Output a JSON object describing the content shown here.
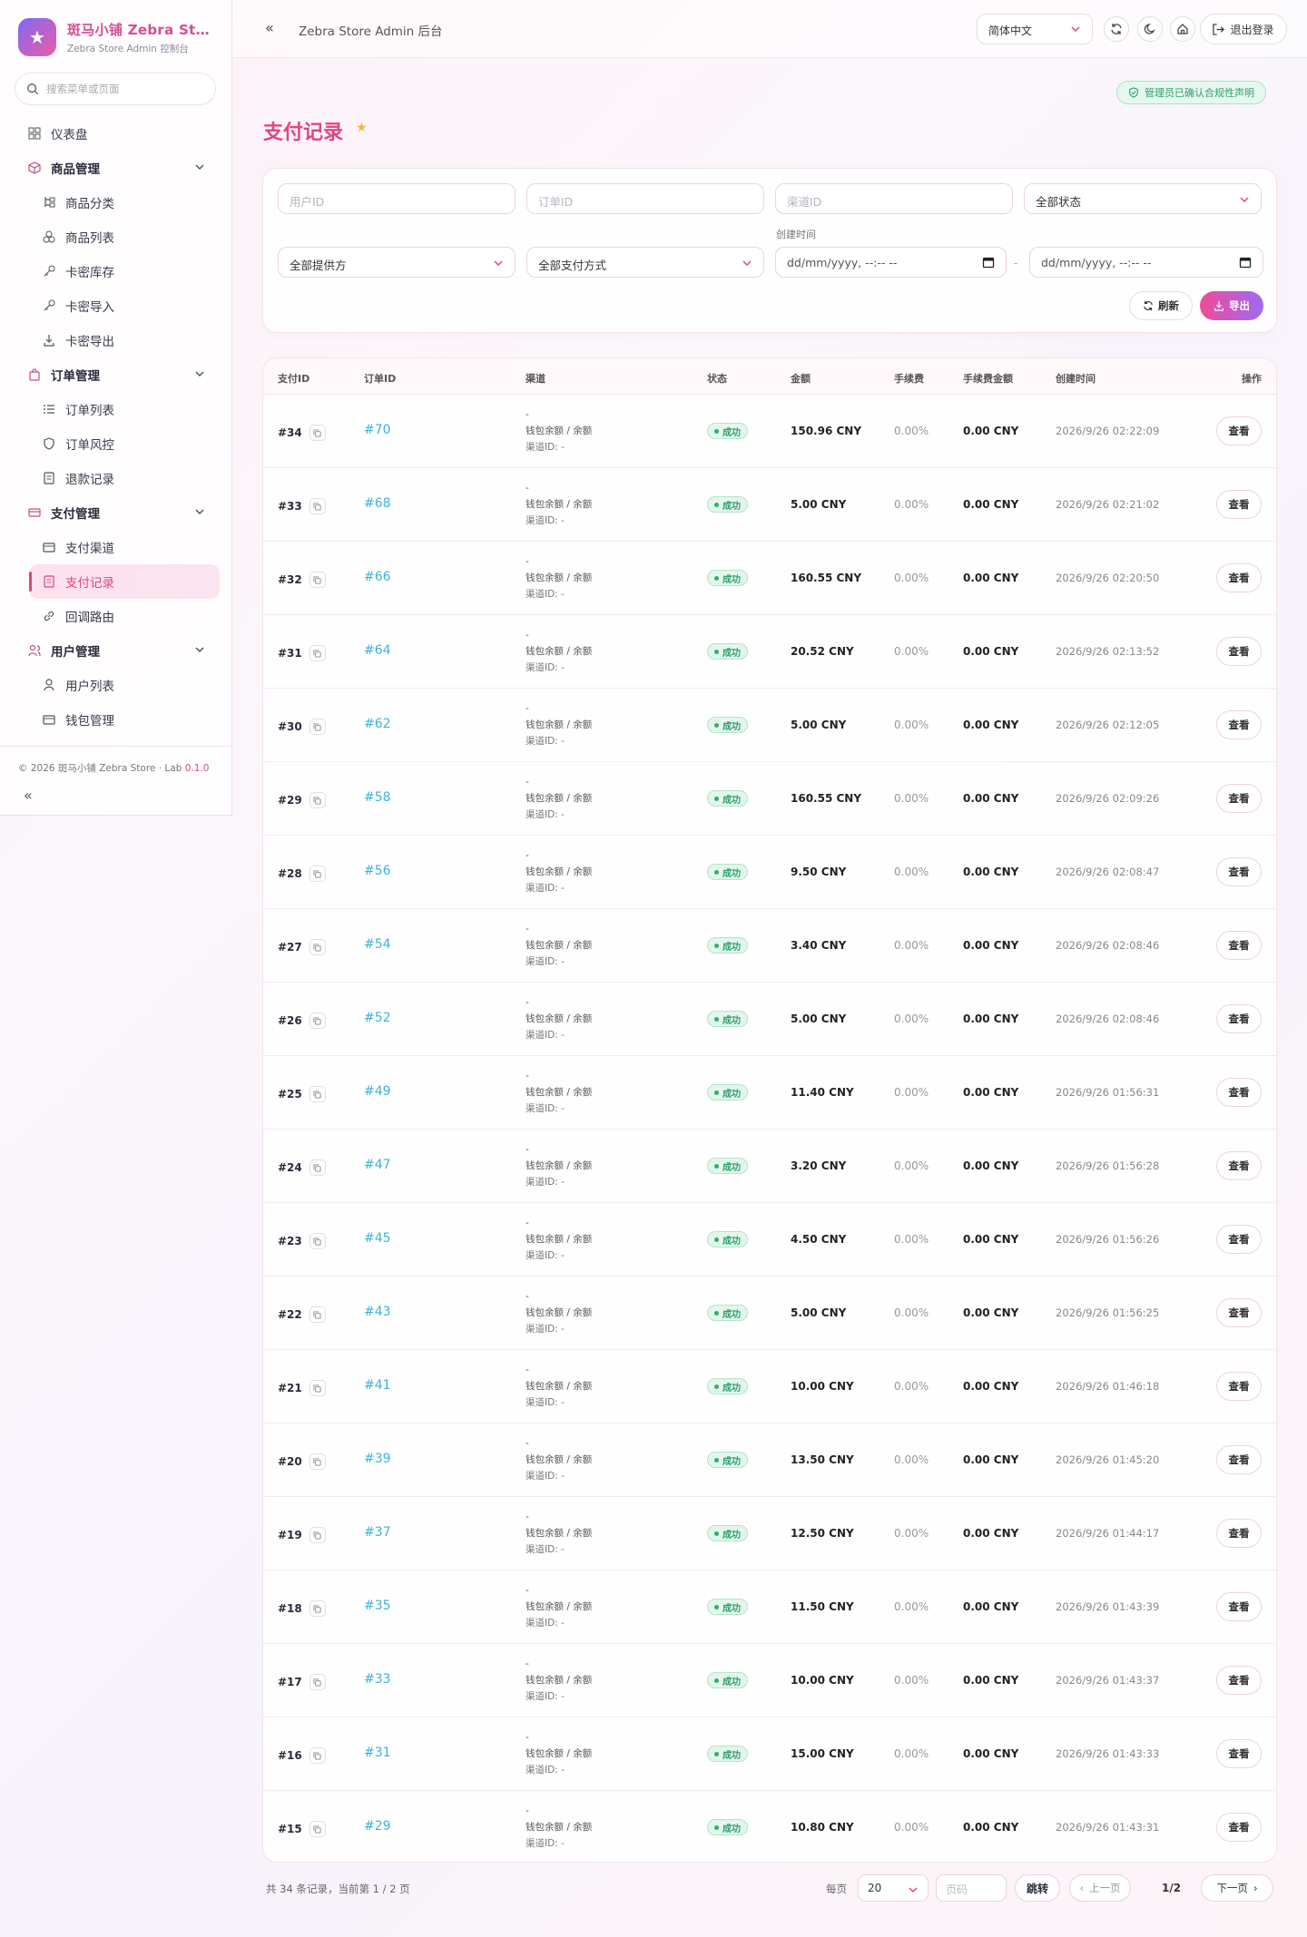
{
  "brand": {
    "title": "斑马小铺 Zebra St…",
    "subtitle": "Zebra Store Admin 控制台"
  },
  "sidebar": {
    "search_placeholder": "搜索菜单或页面",
    "dashboard": "仪表盘",
    "groups": [
      {
        "label": "商品管理",
        "items": [
          "商品分类",
          "商品列表",
          "卡密库存",
          "卡密导入",
          "卡密导出"
        ]
      },
      {
        "label": "订单管理",
        "items": [
          "订单列表",
          "订单风控",
          "退款记录"
        ]
      },
      {
        "label": "支付管理",
        "items": [
          "支付渠道",
          "支付记录",
          "回调路由"
        ]
      },
      {
        "label": "用户管理",
        "items": [
          "用户列表",
          "钱包管理"
        ]
      }
    ],
    "copyright": "© 2026 斑马小铺 Zebra Store · Lab",
    "version": "0.1.0"
  },
  "topbar": {
    "title": "Zebra Store Admin 后台",
    "language": "简体中文",
    "logout": "退出登录"
  },
  "compliance": "管理员已确认合规性声明",
  "page_title": "支付记录",
  "filters": {
    "user_id": "用户ID",
    "order_id": "订单ID",
    "channel_id": "渠道ID",
    "status": "全部状态",
    "provider": "全部提供方",
    "method": "全部支付方式",
    "created_label": "创建时间",
    "date_placeholder": "dd/mm/yyyy, --:-- --",
    "refresh": "刷新",
    "export": "导出"
  },
  "table": {
    "headers": [
      "支付ID",
      "订单ID",
      "渠道",
      "状态",
      "金额",
      "手续费",
      "手续费金额",
      "创建时间",
      "操作"
    ],
    "channel_dash": "-",
    "channel_name": "钱包余额 / 余额",
    "channel_id_label": "渠道ID: -",
    "status_label": "成功",
    "fee": "0.00%",
    "fee_amount": "0.00 CNY",
    "view_label": "查看",
    "rows": [
      {
        "pid": "#34",
        "oid": "#70",
        "amount": "150.96 CNY",
        "time": "2026/9/26 02:22:09"
      },
      {
        "pid": "#33",
        "oid": "#68",
        "amount": "5.00 CNY",
        "time": "2026/9/26 02:21:02"
      },
      {
        "pid": "#32",
        "oid": "#66",
        "amount": "160.55 CNY",
        "time": "2026/9/26 02:20:50"
      },
      {
        "pid": "#31",
        "oid": "#64",
        "amount": "20.52 CNY",
        "time": "2026/9/26 02:13:52"
      },
      {
        "pid": "#30",
        "oid": "#62",
        "amount": "5.00 CNY",
        "time": "2026/9/26 02:12:05"
      },
      {
        "pid": "#29",
        "oid": "#58",
        "amount": "160.55 CNY",
        "time": "2026/9/26 02:09:26"
      },
      {
        "pid": "#28",
        "oid": "#56",
        "amount": "9.50 CNY",
        "time": "2026/9/26 02:08:47"
      },
      {
        "pid": "#27",
        "oid": "#54",
        "amount": "3.40 CNY",
        "time": "2026/9/26 02:08:46"
      },
      {
        "pid": "#26",
        "oid": "#52",
        "amount": "5.00 CNY",
        "time": "2026/9/26 02:08:46"
      },
      {
        "pid": "#25",
        "oid": "#49",
        "amount": "11.40 CNY",
        "time": "2026/9/26 01:56:31"
      },
      {
        "pid": "#24",
        "oid": "#47",
        "amount": "3.20 CNY",
        "time": "2026/9/26 01:56:28"
      },
      {
        "pid": "#23",
        "oid": "#45",
        "amount": "4.50 CNY",
        "time": "2026/9/26 01:56:26"
      },
      {
        "pid": "#22",
        "oid": "#43",
        "amount": "5.00 CNY",
        "time": "2026/9/26 01:56:25"
      },
      {
        "pid": "#21",
        "oid": "#41",
        "amount": "10.00 CNY",
        "time": "2026/9/26 01:46:18"
      },
      {
        "pid": "#20",
        "oid": "#39",
        "amount": "13.50 CNY",
        "time": "2026/9/26 01:45:20"
      },
      {
        "pid": "#19",
        "oid": "#37",
        "amount": "12.50 CNY",
        "time": "2026/9/26 01:44:17"
      },
      {
        "pid": "#18",
        "oid": "#35",
        "amount": "11.50 CNY",
        "time": "2026/9/26 01:43:39"
      },
      {
        "pid": "#17",
        "oid": "#33",
        "amount": "10.00 CNY",
        "time": "2026/9/26 01:43:37"
      },
      {
        "pid": "#16",
        "oid": "#31",
        "amount": "15.00 CNY",
        "time": "2026/9/26 01:43:33"
      },
      {
        "pid": "#15",
        "oid": "#29",
        "amount": "10.80 CNY",
        "time": "2026/9/26 01:43:31"
      }
    ]
  },
  "pagination": {
    "summary": "共 34 条记录，当前第 1 / 2 页",
    "per_page_label": "每页",
    "per_page": "20",
    "page_input_placeholder": "页码",
    "jump": "跳转",
    "prev": "上一页",
    "current": "1/2",
    "next": "下一页"
  },
  "colors": {
    "accent": "#e0457f",
    "link": "#3bb3d9",
    "success": "#2e9e6d"
  }
}
